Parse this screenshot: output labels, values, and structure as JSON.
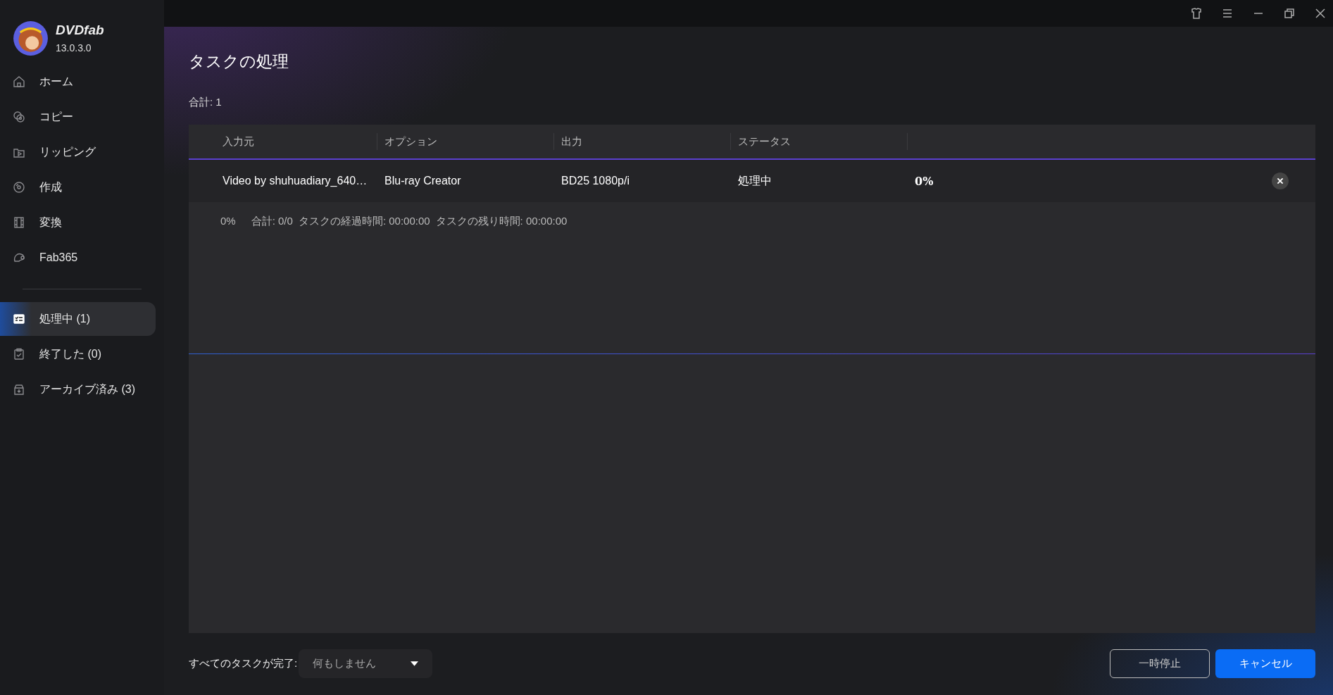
{
  "app": {
    "name": "DVDfab",
    "version": "13.0.3.0"
  },
  "sidebar": {
    "items": [
      {
        "label": "ホーム",
        "selected": false
      },
      {
        "label": "コピー",
        "selected": false
      },
      {
        "label": "リッピング",
        "selected": false
      },
      {
        "label": "作成",
        "selected": false
      },
      {
        "label": "変換",
        "selected": false
      },
      {
        "label": "Fab365",
        "selected": false
      }
    ],
    "task_items": [
      {
        "label": "処理中 (1)",
        "selected": true
      },
      {
        "label": "終了した (0)",
        "selected": false
      },
      {
        "label": "アーカイブ済み (3)",
        "selected": false
      }
    ]
  },
  "page": {
    "title": "タスクの処理",
    "total": "合計: 1"
  },
  "table": {
    "columns": [
      "入力元",
      "オプション",
      "出力",
      "ステータス"
    ],
    "rows": [
      {
        "input": "Video by shuhuadiary_640…",
        "option": "Blu-ray Creator",
        "output": "BD25 1080p/i",
        "status": "処理中",
        "progress": "0%"
      }
    ]
  },
  "summary": [
    "0%",
    "合計: 0/0",
    "タスクの経過時間: 00:00:00",
    "タスクの残り時間: 00:00:00"
  ],
  "footer": {
    "label": "すべてのタスクが完了:",
    "dropdown_value": "何もしません",
    "buttons": [
      {
        "label": "一時停止",
        "kind": "secondary"
      },
      {
        "label": "キャンセル",
        "kind": "primary"
      }
    ]
  }
}
